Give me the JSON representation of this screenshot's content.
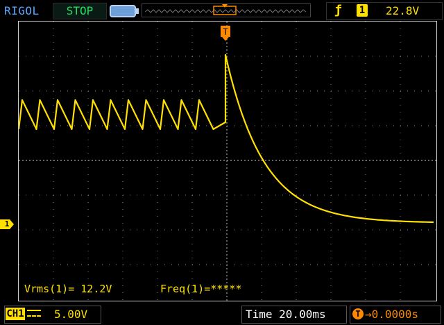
{
  "brand": "RIGOL",
  "run_state": "STOP",
  "trigger": {
    "edge_icon": "rising-edge-icon",
    "channel": "1",
    "level": "22.8V",
    "marker_label": "T"
  },
  "channel": {
    "label": "CH1",
    "marker": "1",
    "volts_per_div": "5.00V",
    "color": "#ffe000"
  },
  "timebase": {
    "text": "Time 20.00ms",
    "offset_icon_label": "T",
    "offset": "→0.0000s"
  },
  "measurements": {
    "vrms": "Vrms(1)= 12.2V",
    "freq": "Freq(1)=*****"
  },
  "colors": {
    "trace": "#ffe000",
    "trigger": "#ff8a00",
    "status_stop": "#20e060",
    "brand": "#5aa8ff"
  }
}
